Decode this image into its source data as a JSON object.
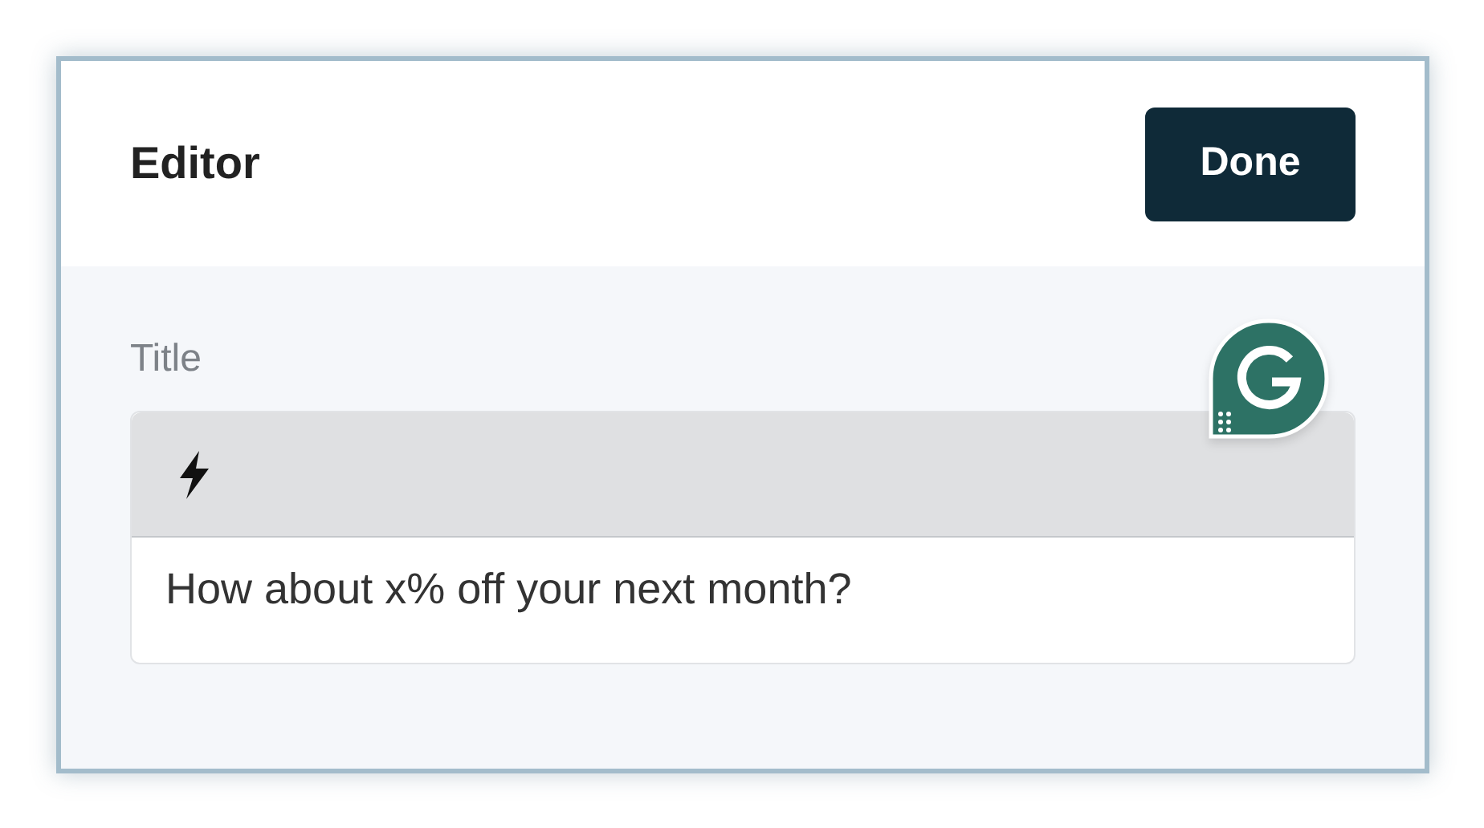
{
  "header": {
    "title": "Editor",
    "done_button": "Done"
  },
  "field": {
    "label": "Title",
    "value": "How about x% off your next month?"
  }
}
